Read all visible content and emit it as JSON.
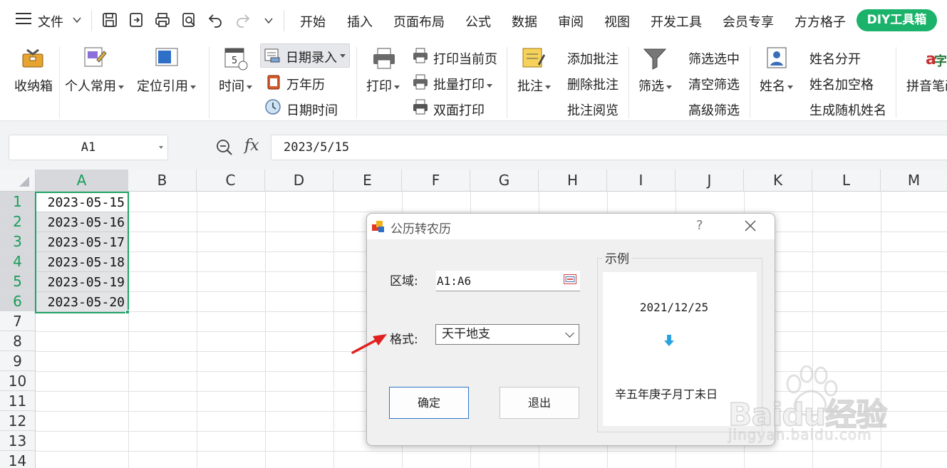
{
  "menubar": {
    "file": "文件",
    "tabs": [
      "开始",
      "插入",
      "页面布局",
      "公式",
      "数据",
      "审阅",
      "视图",
      "开发工具",
      "会员专享",
      "方方格子"
    ],
    "diy": "DIY工具箱"
  },
  "ribbon": {
    "storage": "收纳箱",
    "personal": "个人常用",
    "locate": "定位引用",
    "time": "时间",
    "date_entry": "日期录入",
    "calendar": "万年历",
    "date_time": "日期时间",
    "print": "打印",
    "print_current": "打印当前页",
    "batch_print": "批量打印",
    "duplex_print": "双面打印",
    "comment": "批注",
    "add_comment": "添加批注",
    "delete_comment": "删除批注",
    "read_comment": "批注阅览",
    "filter": "筛选",
    "filter_selected": "筛选选中",
    "clear_filter": "清空筛选",
    "advanced_filter": "高级筛选",
    "name": "姓名",
    "name_split": "姓名分开",
    "name_space": "姓名加空格",
    "random_name": "生成随机姓名",
    "pinyin": "拼音笔画"
  },
  "formula_bar": {
    "name_box": "A1",
    "fx": "fx",
    "formula": "2023/5/15"
  },
  "sheet": {
    "columns": [
      "A",
      "B",
      "C",
      "D",
      "E",
      "F",
      "G",
      "H",
      "I",
      "J",
      "K",
      "L",
      "M"
    ],
    "rows": [
      "1",
      "2",
      "3",
      "4",
      "5",
      "6",
      "7",
      "8",
      "9",
      "10",
      "11",
      "12",
      "13",
      "14"
    ],
    "cells_a": [
      "2023-05-15",
      "2023-05-16",
      "2023-05-17",
      "2023-05-18",
      "2023-05-19",
      "2023-05-20"
    ]
  },
  "dialog": {
    "title": "公历转农历",
    "help": "?",
    "range_label": "区域:",
    "range_value": "A1:A6",
    "format_label": "格式:",
    "format_value": "天干地支",
    "ok": "确定",
    "exit": "退出",
    "example_title": "示例",
    "example_date": "2021/12/25",
    "example_result": "辛五年庚子月丁未日"
  },
  "watermark": {
    "brand": "Baidu经验",
    "url": "jingyan.baidu.com"
  },
  "colors": {
    "accent_green": "#1bb36b",
    "selection_green": "#21a366",
    "primary_blue": "#2e75c8",
    "annotation_red": "#e02020"
  }
}
